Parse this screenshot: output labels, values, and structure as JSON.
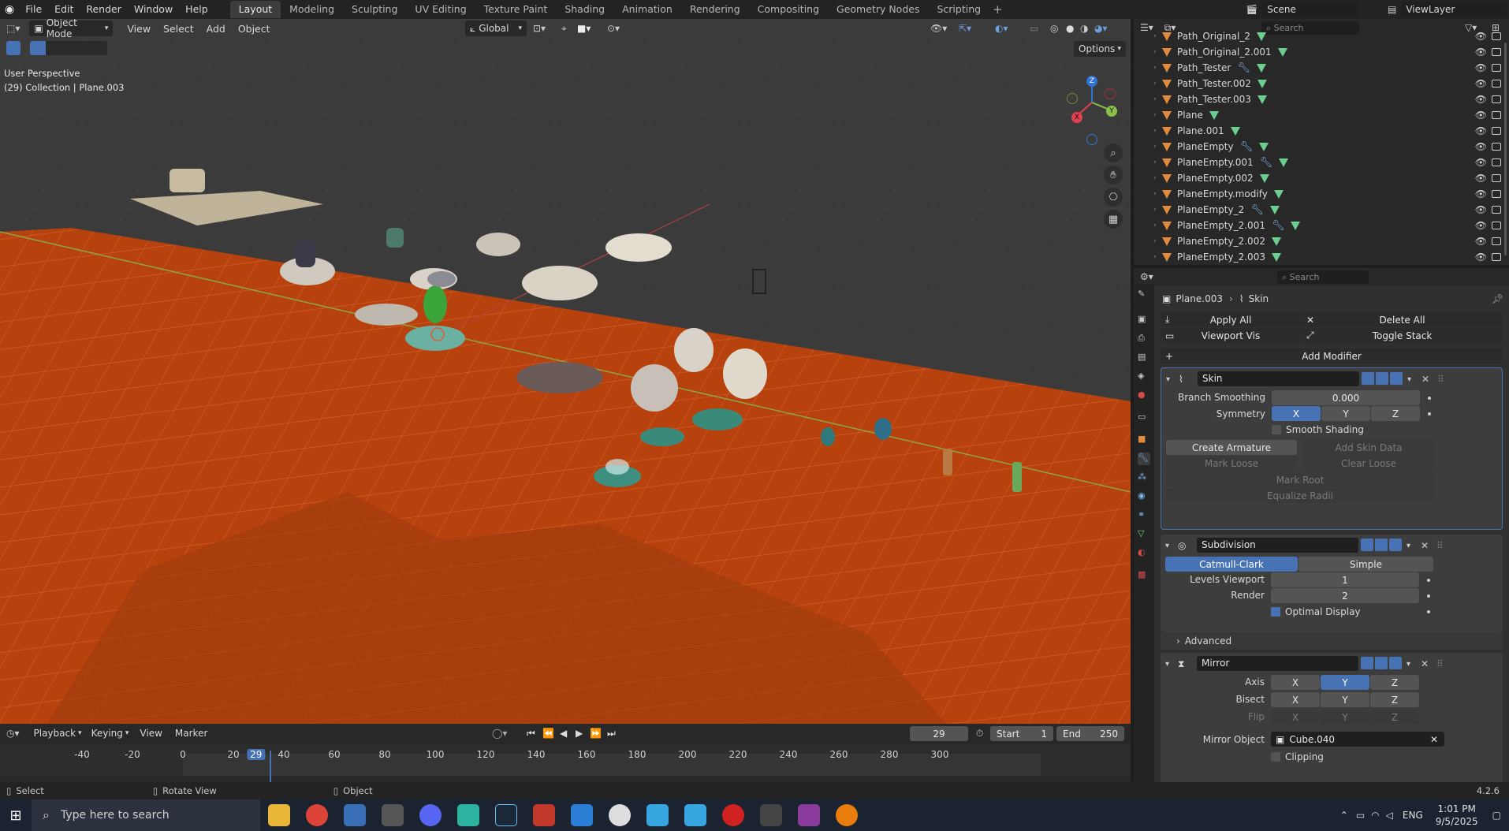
{
  "topbar": {
    "menus": [
      "File",
      "Edit",
      "Render",
      "Window",
      "Help"
    ],
    "workspace_tabs": [
      "Layout",
      "Modeling",
      "Sculpting",
      "UV Editing",
      "Texture Paint",
      "Shading",
      "Animation",
      "Rendering",
      "Compositing",
      "Geometry Nodes",
      "Scripting"
    ],
    "active_tab": "Layout",
    "scene": "Scene",
    "view_layer": "ViewLayer"
  },
  "viewport": {
    "mode": "Object Mode",
    "menus": [
      "View",
      "Select",
      "Add",
      "Object"
    ],
    "transform_orientation": "Global",
    "options": "Options",
    "overlay_title": "User Perspective",
    "overlay_subtitle": "(29) Collection | Plane.003",
    "gizmo_axes": {
      "z": "Z",
      "y": "Y",
      "x": "X"
    }
  },
  "outliner": {
    "search_placeholder": "Search",
    "items": [
      {
        "name": "Path_Original_2",
        "modifier": false
      },
      {
        "name": "Path_Original_2.001",
        "modifier": false
      },
      {
        "name": "Path_Tester",
        "modifier": true
      },
      {
        "name": "Path_Tester.002",
        "modifier": false
      },
      {
        "name": "Path_Tester.003",
        "modifier": false
      },
      {
        "name": "Plane",
        "modifier": false
      },
      {
        "name": "Plane.001",
        "modifier": false
      },
      {
        "name": "PlaneEmpty",
        "modifier": true
      },
      {
        "name": "PlaneEmpty.001",
        "modifier": true
      },
      {
        "name": "PlaneEmpty.002",
        "modifier": false
      },
      {
        "name": "PlaneEmpty.modify",
        "modifier": false
      },
      {
        "name": "PlaneEmpty_2",
        "modifier": true
      },
      {
        "name": "PlaneEmpty_2.001",
        "modifier": true
      },
      {
        "name": "PlaneEmpty_2.002",
        "modifier": false
      },
      {
        "name": "PlaneEmpty_2.003",
        "modifier": false
      }
    ]
  },
  "properties": {
    "search_placeholder": "Search",
    "breadcrumb_object": "Plane.003",
    "breadcrumb_modifier": "Skin",
    "apply_all": "Apply All",
    "delete_all": "Delete All",
    "viewport_vis": "Viewport Vis",
    "toggle_stack": "Toggle Stack",
    "add_modifier": "Add Modifier",
    "skin": {
      "name": "Skin",
      "branch_smoothing_label": "Branch Smoothing",
      "branch_smoothing": "0.000",
      "symmetry_label": "Symmetry",
      "axes": [
        "X",
        "Y",
        "Z"
      ],
      "smooth_shading": "Smooth Shading",
      "create_armature": "Create Armature",
      "add_skin_data": "Add Skin Data",
      "mark_loose": "Mark Loose",
      "clear_loose": "Clear Loose",
      "mark_root": "Mark Root",
      "equalize_radii": "Equalize Radii"
    },
    "subdivision": {
      "name": "Subdivision",
      "catmull_clark": "Catmull-Clark",
      "simple": "Simple",
      "levels_viewport_label": "Levels Viewport",
      "levels_viewport": "1",
      "render_label": "Render",
      "render": "2",
      "optimal_display": "Optimal Display",
      "advanced": "Advanced"
    },
    "mirror": {
      "name": "Mirror",
      "axis_label": "Axis",
      "bisect_label": "Bisect",
      "flip_label": "Flip",
      "axes": [
        "X",
        "Y",
        "Z"
      ],
      "mirror_object_label": "Mirror Object",
      "mirror_object": "Cube.040",
      "clipping": "Clipping"
    }
  },
  "timeline": {
    "menus": [
      "Playback",
      "Keying",
      "View",
      "Marker"
    ],
    "current_frame": "29",
    "start_label": "Start",
    "start": "1",
    "end_label": "End",
    "end": "250",
    "ticks": [
      "-40",
      "-20",
      "0",
      "20",
      "29",
      "40",
      "60",
      "80",
      "100",
      "120",
      "140",
      "160",
      "180",
      "200",
      "220",
      "240",
      "260",
      "280",
      "300"
    ]
  },
  "statusbar": {
    "select": "Select",
    "rotate_view": "Rotate View",
    "object": "Object",
    "version": "4.2.6"
  },
  "taskbar": {
    "search_placeholder": "Type here to search",
    "language": "ENG",
    "time": "1:01 PM",
    "date": "9/5/2025"
  },
  "colors": {
    "accent": "#4772b3",
    "orange_plane": "#c04a12",
    "object_orange": "#e08a3c",
    "mesh_green": "#6ccf8f"
  }
}
